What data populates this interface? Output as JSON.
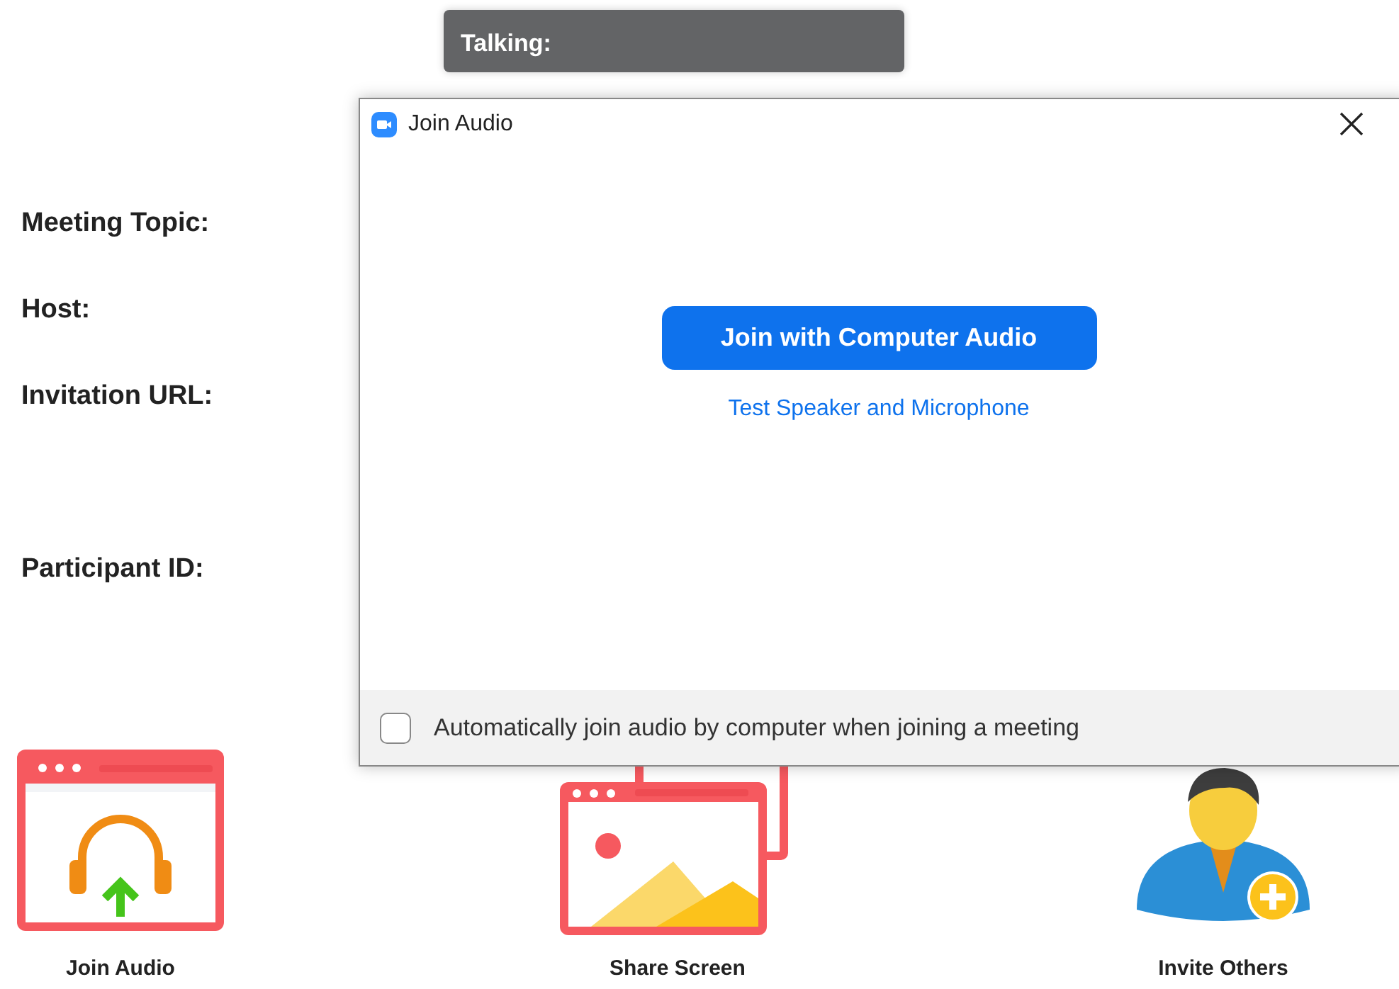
{
  "talking_bar": {
    "label": "Talking:"
  },
  "meeting_info": [
    {
      "label": "Meeting Topic:"
    },
    {
      "label": "Host:"
    },
    {
      "label": "Invitation URL:"
    },
    {
      "label": "Participant ID:"
    }
  ],
  "actions": [
    {
      "kind": "audio",
      "label": "Join Audio"
    },
    {
      "kind": "share",
      "label": "Share Screen"
    },
    {
      "kind": "invite",
      "label": "Invite Others"
    }
  ],
  "dialog": {
    "title": "Join Audio",
    "primary_button": "Join with Computer Audio",
    "link": "Test Speaker and Microphone",
    "auto_join": {
      "label": "Automatically join audio by computer when joining a meeting",
      "checked": false
    }
  }
}
